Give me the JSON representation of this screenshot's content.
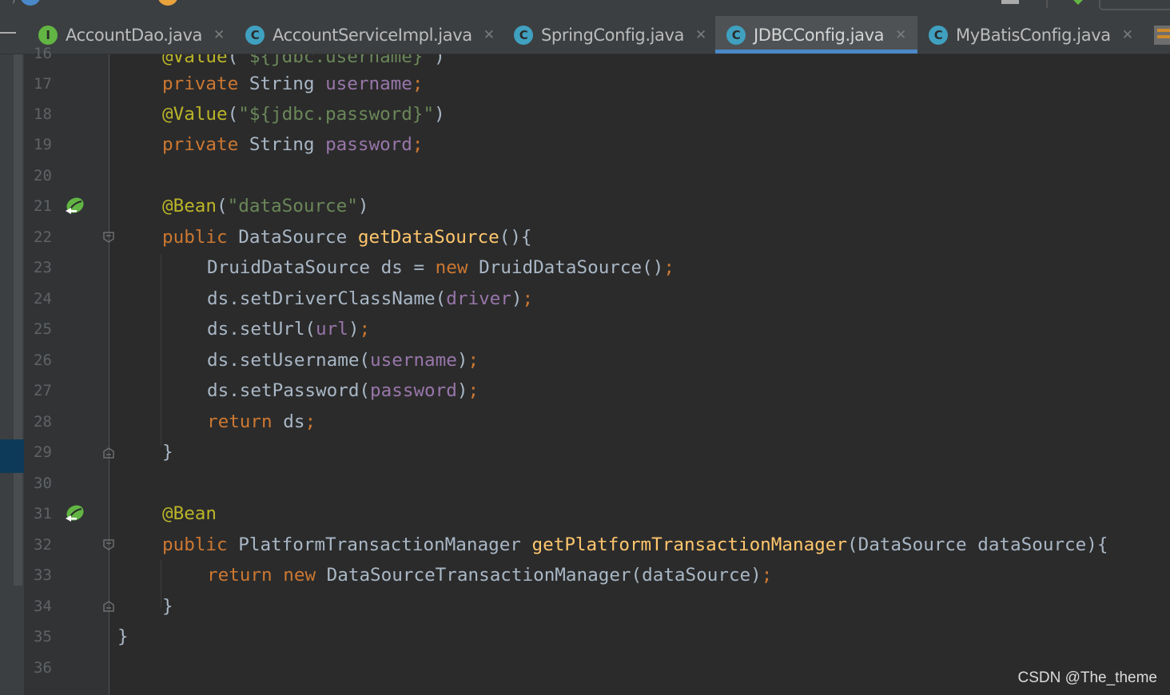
{
  "tabs": [
    {
      "label": "AccountDao.java",
      "icon": "I",
      "active": false
    },
    {
      "label": "AccountServiceImpl.java",
      "icon": "C",
      "active": false
    },
    {
      "label": "SpringConfig.java",
      "icon": "C",
      "active": false
    },
    {
      "label": "JDBCConfig.java",
      "icon": "C",
      "active": true
    },
    {
      "label": "MyBatisConfig.java",
      "icon": "C",
      "active": false
    }
  ],
  "line_numbers": [
    "16",
    "17",
    "18",
    "19",
    "20",
    "21",
    "22",
    "23",
    "24",
    "25",
    "26",
    "27",
    "28",
    "29",
    "30",
    "31",
    "32",
    "33",
    "34",
    "35",
    "36"
  ],
  "code": {
    "l16": {
      "ann": "@Value",
      "open": "(",
      "str": "\"${jdbc.username}\"",
      "close": ")"
    },
    "l17": {
      "kw": "private",
      "type": "String",
      "field": "username",
      "semi": ";"
    },
    "l18": {
      "ann": "@Value",
      "open": "(",
      "str": "\"${jdbc.password}\"",
      "close": ")"
    },
    "l19": {
      "kw": "private",
      "type": "String",
      "field": "password",
      "semi": ";"
    },
    "l21": {
      "ann": "@Bean",
      "open": "(",
      "str": "\"dataSource\"",
      "close": ")"
    },
    "l22": {
      "kw": "public",
      "type": "DataSource",
      "method": "getDataSource",
      "rest": "(){"
    },
    "l23": {
      "a": "DruidDataSource ds = ",
      "kw": "new",
      "b": " DruidDataSource()",
      "semi": ";"
    },
    "l24": {
      "a": "ds.setDriverClassName(",
      "field": "driver",
      "b": ")",
      "semi": ";"
    },
    "l25": {
      "a": "ds.setUrl(",
      "field": "url",
      "b": ")",
      "semi": ";"
    },
    "l26": {
      "a": "ds.setUsername(",
      "field": "username",
      "b": ")",
      "semi": ";"
    },
    "l27": {
      "a": "ds.setPassword(",
      "field": "password",
      "b": ")",
      "semi": ";"
    },
    "l28": {
      "kw": "return",
      "a": " ds",
      "semi": ";"
    },
    "l29": {
      "a": "}"
    },
    "l31": {
      "ann": "@Bean"
    },
    "l32": {
      "kw": "public",
      "type": "PlatformTransactionManager",
      "method": "getPlatformTransactionManager",
      "rest": "(DataSource dataSource){"
    },
    "l33": {
      "kw1": "return",
      "kw2": "new",
      "a": " DataSourceTransactionManager(dataSource)",
      "semi": ";"
    },
    "l34": {
      "a": "}"
    },
    "l35": {
      "a": "}"
    }
  },
  "watermark": "CSDN @The_theme",
  "colors": {
    "keyword": "#cc7832",
    "string": "#6a8759",
    "annotation": "#bbb529",
    "field": "#9876aa",
    "method": "#ffc66d",
    "plain": "#a9b7c6",
    "tab_underline": "#4a88c7"
  }
}
